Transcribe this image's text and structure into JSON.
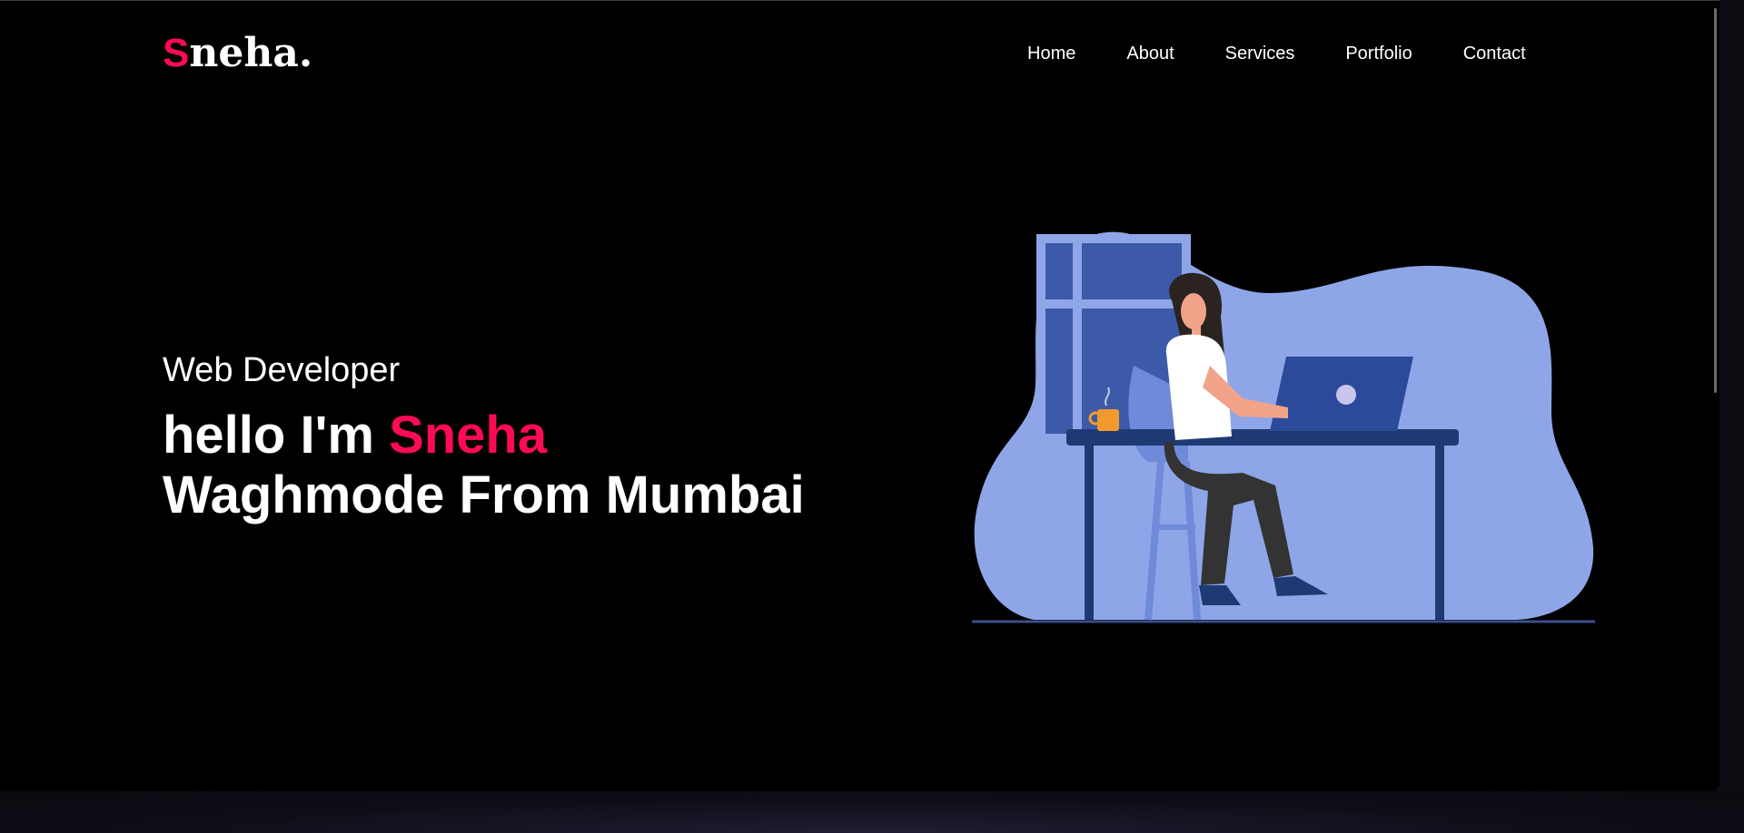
{
  "logo": {
    "initial": "S",
    "rest": "neha."
  },
  "nav": {
    "items": [
      "Home",
      "About",
      "Services",
      "Portfolio",
      "Contact"
    ]
  },
  "hero": {
    "role": "Web Developer",
    "greeting": "hello I'm ",
    "first_name": "Sneha",
    "line2": "Waghmode From Mumbai"
  },
  "colors": {
    "accent": "#ff0a54",
    "background": "#000000",
    "blob": "#8ea6e8",
    "navy": "#1e3a73"
  }
}
